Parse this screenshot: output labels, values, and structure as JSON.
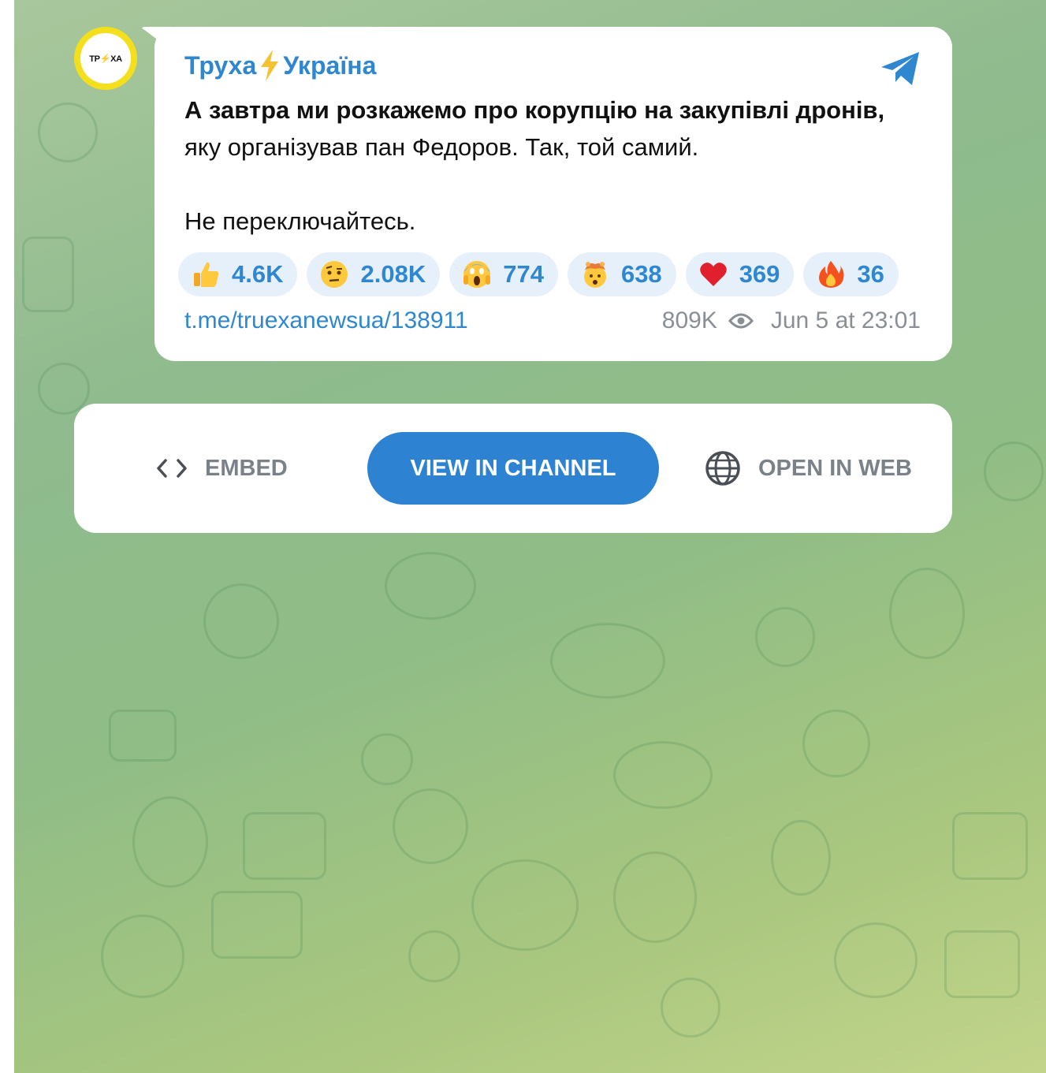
{
  "post": {
    "avatar_text": "ТР⚡ХА",
    "channel_name_part1": "Труха",
    "channel_name_part2": "Україна",
    "text_bold": "А завтра ми розкажемо про корупцію на закупівлі дронів,",
    "text_regular": " яку організував пан Федоров. Так, той самий.",
    "text_second_paragraph": "Не переключайтесь.",
    "reactions": [
      {
        "icon": "thumbs-up-icon",
        "count": "4.6K"
      },
      {
        "icon": "face-with-raised-eyebrow-icon",
        "count": "2.08K"
      },
      {
        "icon": "screaming-face-icon",
        "count": "774"
      },
      {
        "icon": "exploding-head-icon",
        "count": "638"
      },
      {
        "icon": "red-heart-icon",
        "count": "369"
      },
      {
        "icon": "fire-icon",
        "count": "36"
      }
    ],
    "link": "t.me/truexanewsua/138911",
    "views": "809K",
    "date": "Jun 5 at 23:01"
  },
  "actions": {
    "embed_label": "EMBED",
    "view_label": "VIEW IN CHANNEL",
    "web_label": "OPEN IN WEB"
  },
  "colors": {
    "accent": "#2f87cf",
    "button": "#2d83d1",
    "avatar_ring": "#f3df1c"
  }
}
